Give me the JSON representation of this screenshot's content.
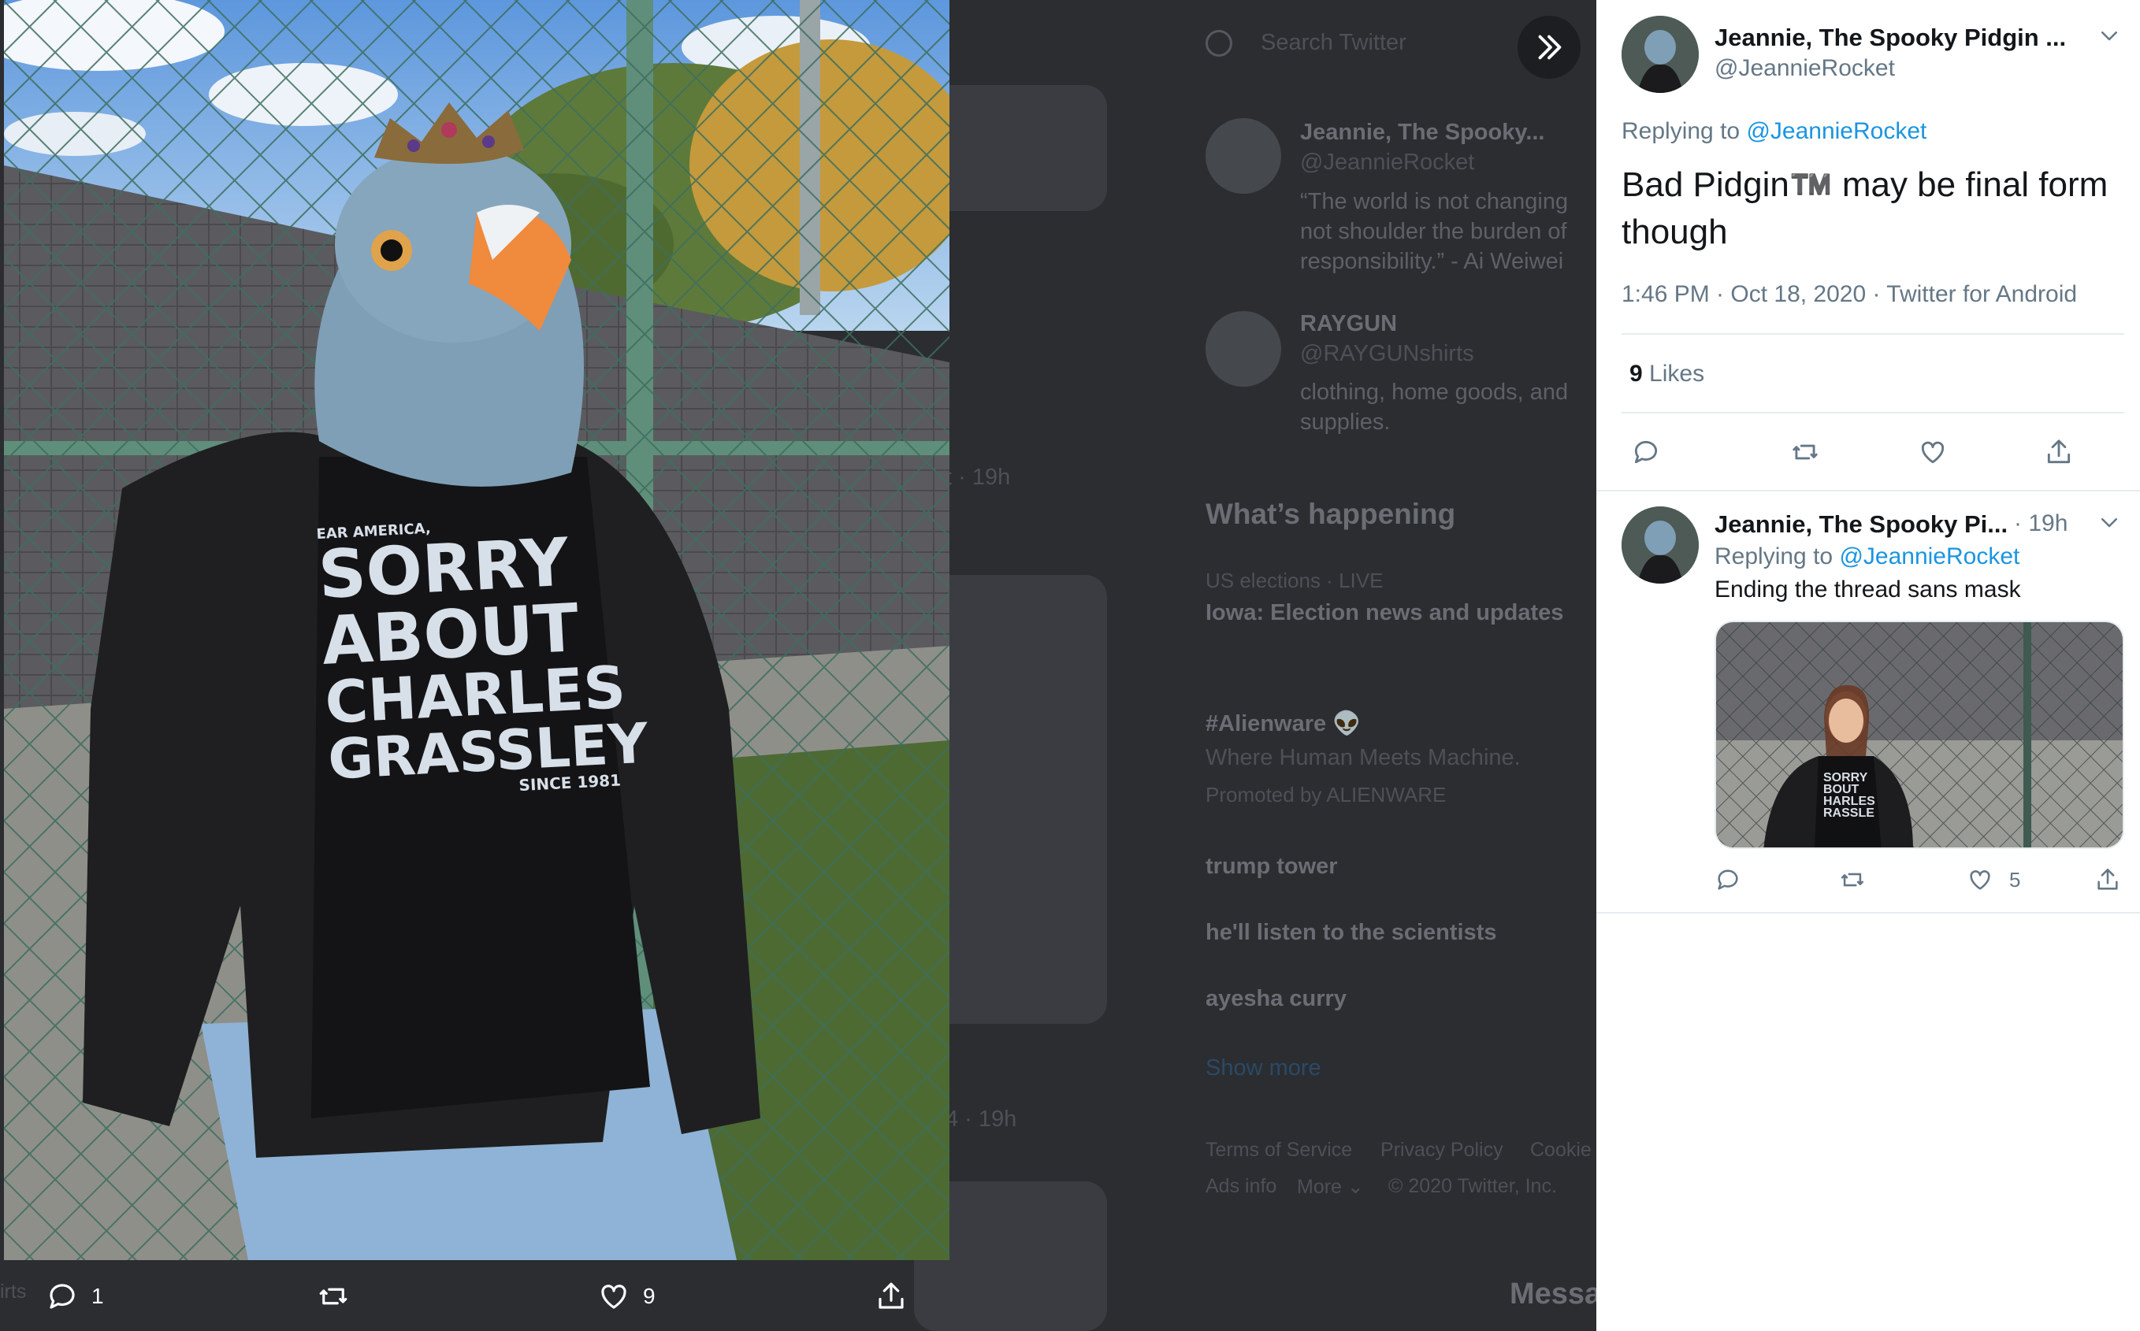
{
  "search": {
    "placeholder": "Search Twitter"
  },
  "media": {
    "shirt_lines": [
      "EAR AMERICA,",
      "SORRY",
      "ABOUT",
      "CHARLES",
      "GRASSLEY",
      "SINCE 1981"
    ],
    "reply_count": "1",
    "like_count": "9",
    "colors": {
      "sky": "#7fb4ea",
      "mask": "#7f9fb6",
      "beak": "#f08a3c",
      "jacket": "#1f1f21",
      "shirt": "#141416",
      "jeans": "#8fb3d6",
      "fence": "#3d6e5e"
    }
  },
  "background": {
    "who_to_follow": [
      {
        "name": "Jeannie, The Spooky...",
        "handle": "@JeannieRocket",
        "bio": [
          "“The world is not changing",
          "not shoulder the burden of",
          "responsibility.” - Ai Weiwei"
        ]
      },
      {
        "name": "RAYGUN",
        "handle": "@RAYGUNshirts",
        "bio": [
          "clothing, home goods, and",
          "supplies."
        ]
      }
    ],
    "whats_happening": {
      "title": "What’s happening",
      "items": [
        {
          "context": "US elections · LIVE",
          "title": "Iowa: Election news and updates"
        },
        {
          "title": "#Alienware 👽",
          "sub": "Where Human Meets Machine.",
          "promo": "Promoted by ALIENWARE"
        },
        {
          "title": "trump tower"
        },
        {
          "title": "he'll listen to the scientists"
        },
        {
          "title": "ayesha curry"
        }
      ],
      "show_more": "Show more"
    },
    "footer": [
      "Terms of Service",
      "Privacy Policy",
      "Cookie",
      "Ads info",
      "More ⌄",
      "© 2020 Twitter, Inc."
    ],
    "timeline_meta": [
      "t · 19h",
      "4 · 19h"
    ],
    "messages_label": "Messa",
    "left_fragment": "irts"
  },
  "panel": {
    "main_tweet": {
      "name": "Jeannie, The Spooky Pidgin ...",
      "handle": "@JeannieRocket",
      "replying_prefix": "Replying to",
      "replying_handle": "@JeannieRocket",
      "text": "Bad Pidgin™️ may be final form though",
      "meta": "1:46 PM · Oct 18, 2020 · Twitter for Android",
      "likes_count": "9",
      "likes_label": "Likes"
    },
    "reply_tweet": {
      "name": "Jeannie, The Spooky Pi...",
      "time": "· 19h",
      "replying_prefix": "Replying to",
      "replying_handle": "@JeannieRocket",
      "text": "Ending the thread sans mask",
      "like_count": "5",
      "shirt_lines": [
        "SORRY",
        "BOUT",
        "HARLES",
        "RASSLE"
      ]
    },
    "colors": {
      "link": "#1b95e0",
      "secondary": "#657786",
      "divider": "#e6ecf0"
    }
  }
}
